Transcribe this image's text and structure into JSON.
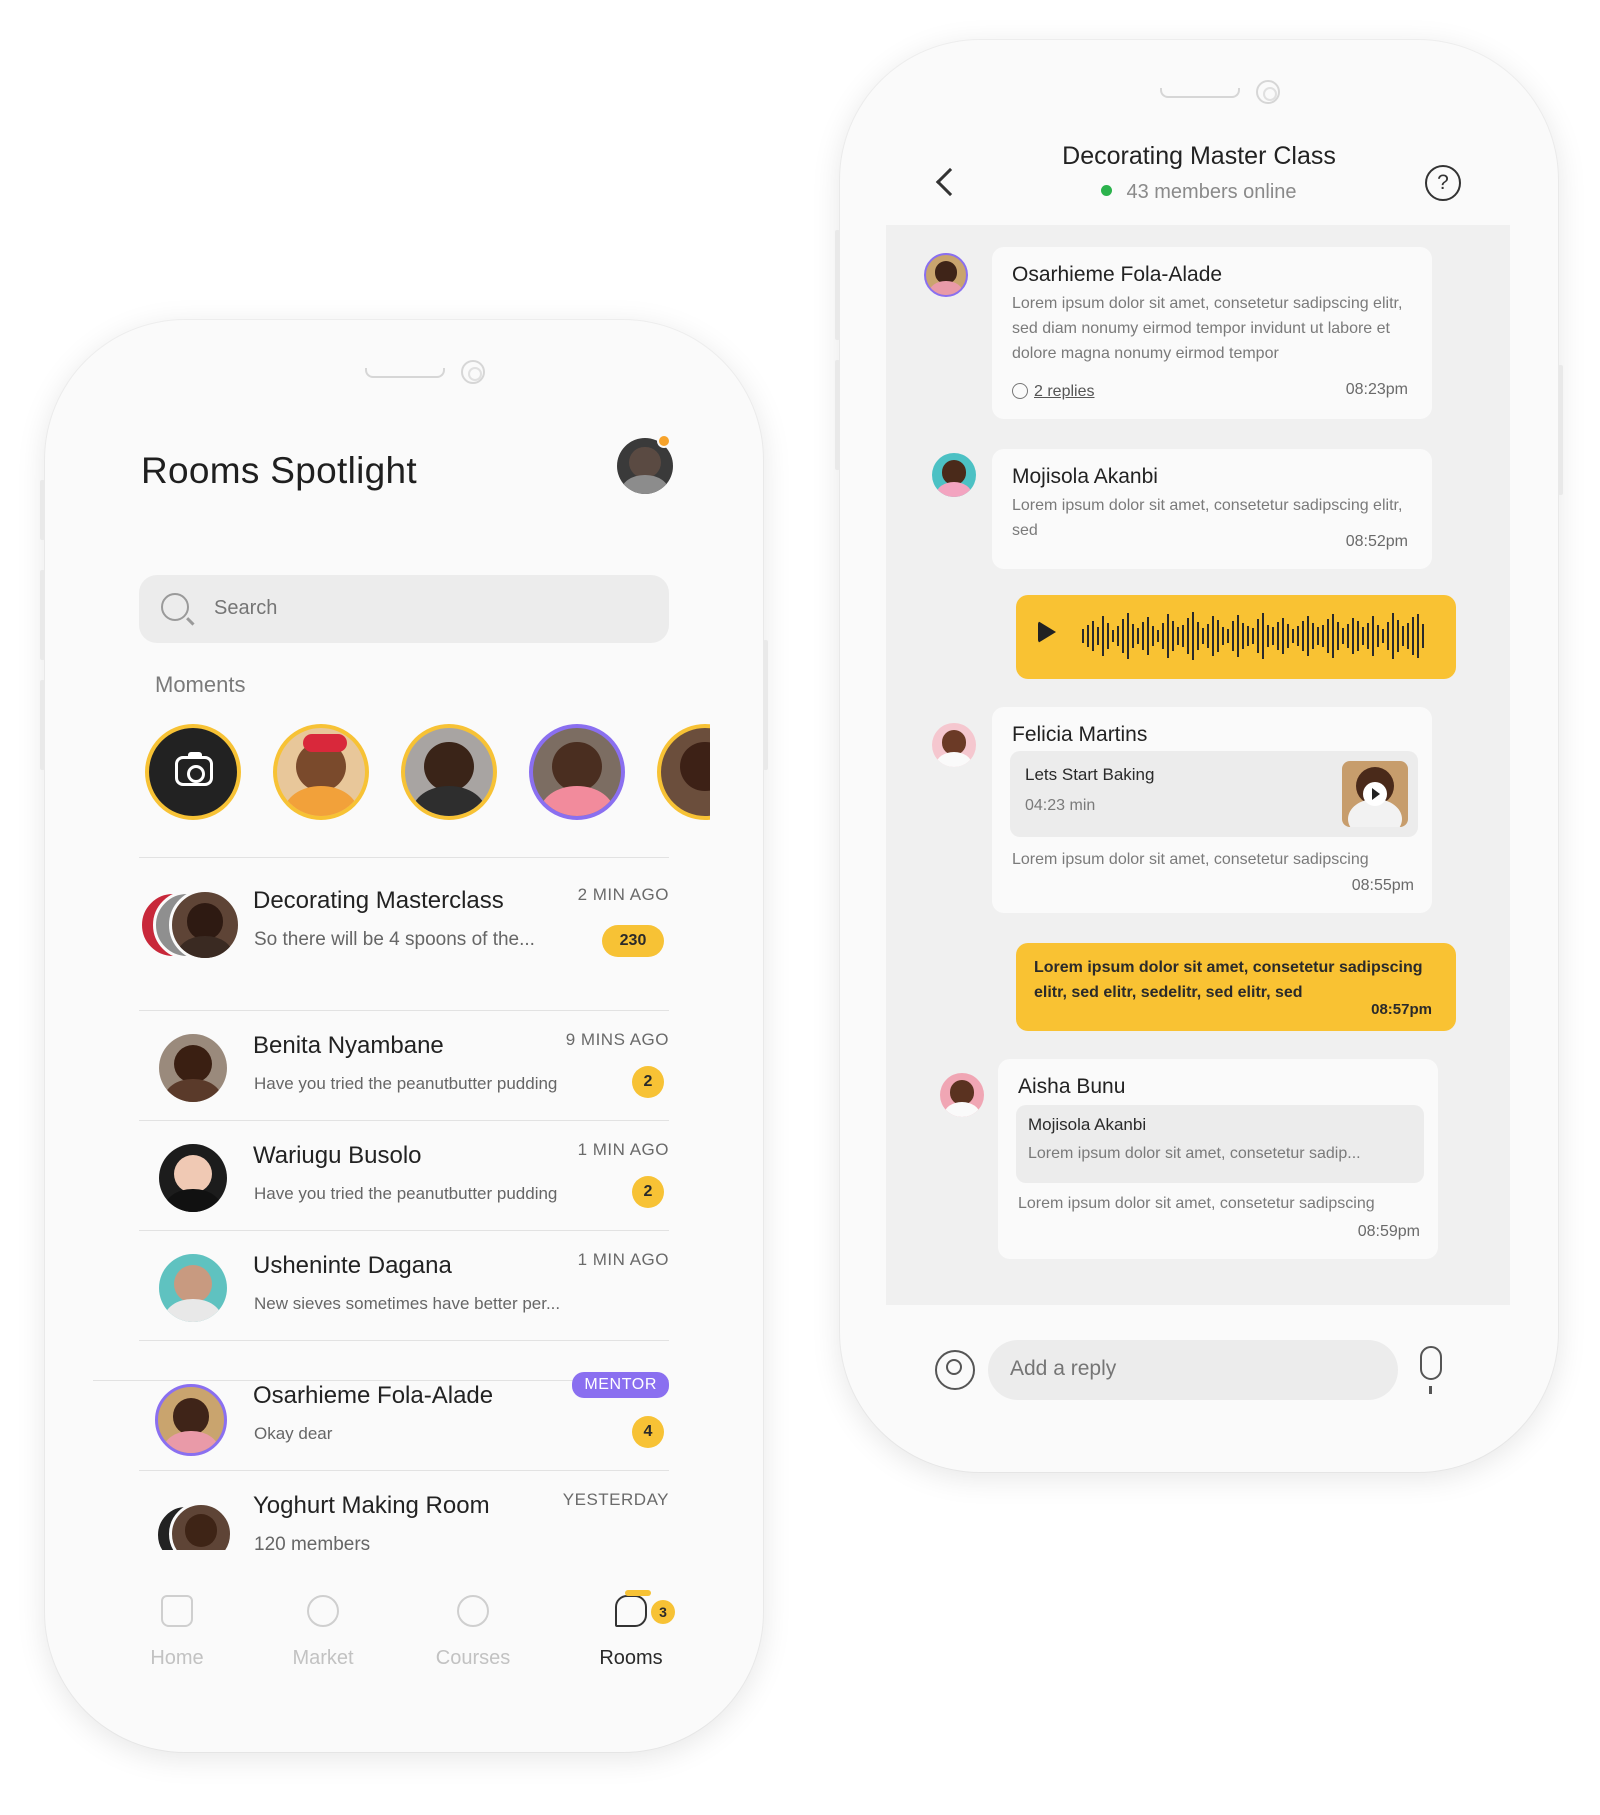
{
  "rooms_screen": {
    "title": "Rooms Spotlight",
    "search_placeholder": "Search",
    "moments_label": "Moments",
    "rooms": [
      {
        "name": "Decorating Masterclass",
        "preview": "So there will be 4 spoons of the...",
        "time": "2 MIN AGO",
        "badge": "230"
      },
      {
        "name": "Benita Nyambane",
        "preview": "Have you tried the peanutbutter pudding",
        "time": "9 MINS AGO",
        "badge": "2"
      },
      {
        "name": "Wariugu Busolo",
        "preview": "Have you tried the peanutbutter pudding",
        "time": "1 MIN AGO",
        "badge": "2"
      },
      {
        "name": "Usheninte Dagana",
        "preview": "New sieves sometimes have better per...",
        "time": "1 MIN AGO",
        "badge": ""
      },
      {
        "name": "Osarhieme Fola-Alade",
        "preview": "Okay dear",
        "time": "MENTOR",
        "badge": "4"
      },
      {
        "name": "Yoghurt Making Room",
        "preview": "120 members",
        "time": "YESTERDAY",
        "badge": ""
      }
    ],
    "tabs": [
      {
        "label": "Home",
        "icon": "home-icon"
      },
      {
        "label": "Market",
        "icon": "market-icon"
      },
      {
        "label": "Courses",
        "icon": "courses-icon"
      },
      {
        "label": "Rooms",
        "icon": "rooms-icon",
        "badge": "3"
      }
    ]
  },
  "chat_screen": {
    "title": "Decorating Master Class",
    "online": "43 members online",
    "messages": [
      {
        "author": "Osarhieme Fola-Alade",
        "body": "Lorem ipsum dolor sit amet, consetetur sadipscing elitr, sed diam nonumy eirmod tempor invidunt ut labore et dolore magna nonumy eirmod tempor",
        "replies": "2 replies",
        "time": "08:23pm"
      },
      {
        "author": "Mojisola Akanbi",
        "body": "Lorem ipsum dolor sit amet, consetetur sadipscing elitr, sed",
        "time": "08:52pm"
      },
      {
        "author": "Felicia Martins",
        "attachment_title": "Lets Start Baking",
        "attachment_duration": "04:23 min",
        "body": "Lorem ipsum dolor sit amet, consetetur sadipscing",
        "time": "08:55pm"
      },
      {
        "author": "me",
        "body": "Lorem ipsum dolor sit amet, consetetur sadipscing elitr, sed elitr, sedelitr, sed elitr, sed",
        "time": "08:57pm"
      },
      {
        "author": "Aisha Bunu",
        "quote_author": "Mojisola Akanbi",
        "quote_body": "Lorem ipsum dolor sit amet, consetetur sadip...",
        "body": "Lorem ipsum dolor sit amet, consetetur sadipscing",
        "time": "08:59pm"
      }
    ],
    "reply_placeholder": "Add a reply"
  },
  "colors": {
    "accent": "#f7c235",
    "mentor": "#8a6ff0",
    "online": "#2bb24c"
  }
}
